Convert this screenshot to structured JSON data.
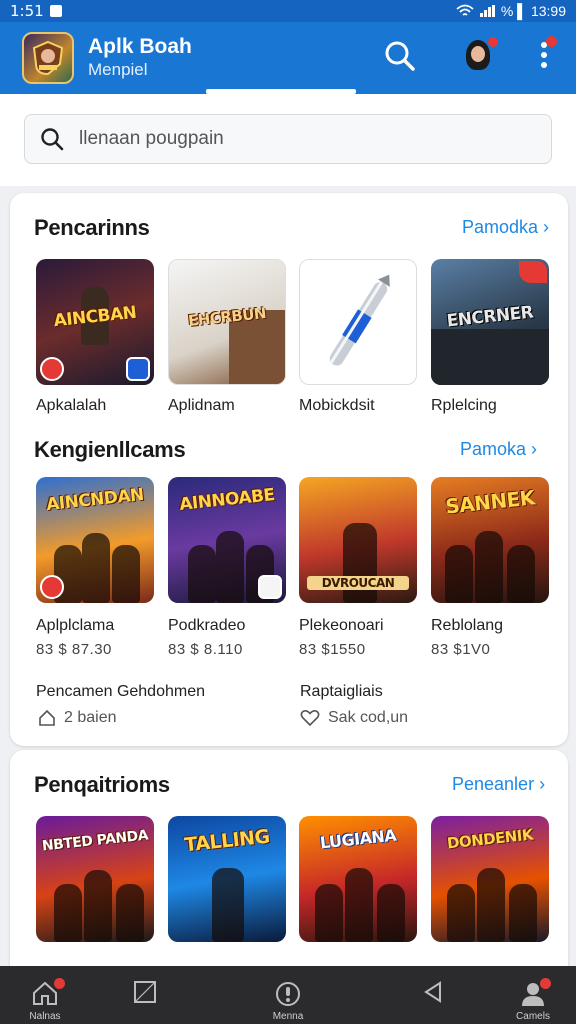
{
  "status_bar": {
    "time": "1:51",
    "right_text": "% ▌ 13:99"
  },
  "app_bar": {
    "title": "Aplk Boah",
    "subtitle": "Menpiel",
    "accent": "#1976d2"
  },
  "search": {
    "placeholder": "llenaan pougpain"
  },
  "section1": {
    "title": "Pencarinns",
    "link": "Pamodka ›",
    "items": [
      {
        "label": "Apkalalah",
        "art": "AINCBAN"
      },
      {
        "label": "Aplidnam",
        "art": "EHCRBUN"
      },
      {
        "label": "Mobickdsit",
        "art": ""
      },
      {
        "label": "Rplelcing",
        "art": "ENCRNER"
      }
    ]
  },
  "section2": {
    "title": "Kengienllcams",
    "link": "Pamoka ›",
    "items": [
      {
        "label": "Aplplclama",
        "price": "83 $ 87.30",
        "art": "AINCNDAN"
      },
      {
        "label": "Podkradeo",
        "price": "83 $ 8.110",
        "art": "AINNOABE"
      },
      {
        "label": "Plekeonoari",
        "price": "83 $1550",
        "art": "DVROUCAN"
      },
      {
        "label": "Reblolang",
        "price": "83 $1V0",
        "art": "SANNEK"
      }
    ],
    "meta_left": {
      "title": "Pencamen Gehdohmen",
      "sub": "2 baien"
    },
    "meta_right": {
      "title": "Raptaigliais",
      "sub": "Sak cod,un"
    }
  },
  "section3": {
    "title": "Penqaitrioms",
    "link": "Peneanler ›",
    "items": [
      {
        "art": "NBTED PANDA"
      },
      {
        "art": "TALLING"
      },
      {
        "art": "LUGIANA"
      },
      {
        "art": "DONDENIK"
      }
    ]
  },
  "bottom_nav": [
    {
      "label": "Nalnas",
      "icon": "home-icon"
    },
    {
      "label": "",
      "icon": "square-icon"
    },
    {
      "label": "Menna",
      "icon": "info-icon"
    },
    {
      "label": "",
      "icon": "back-icon"
    },
    {
      "label": "Camels",
      "icon": "person-icon"
    }
  ]
}
